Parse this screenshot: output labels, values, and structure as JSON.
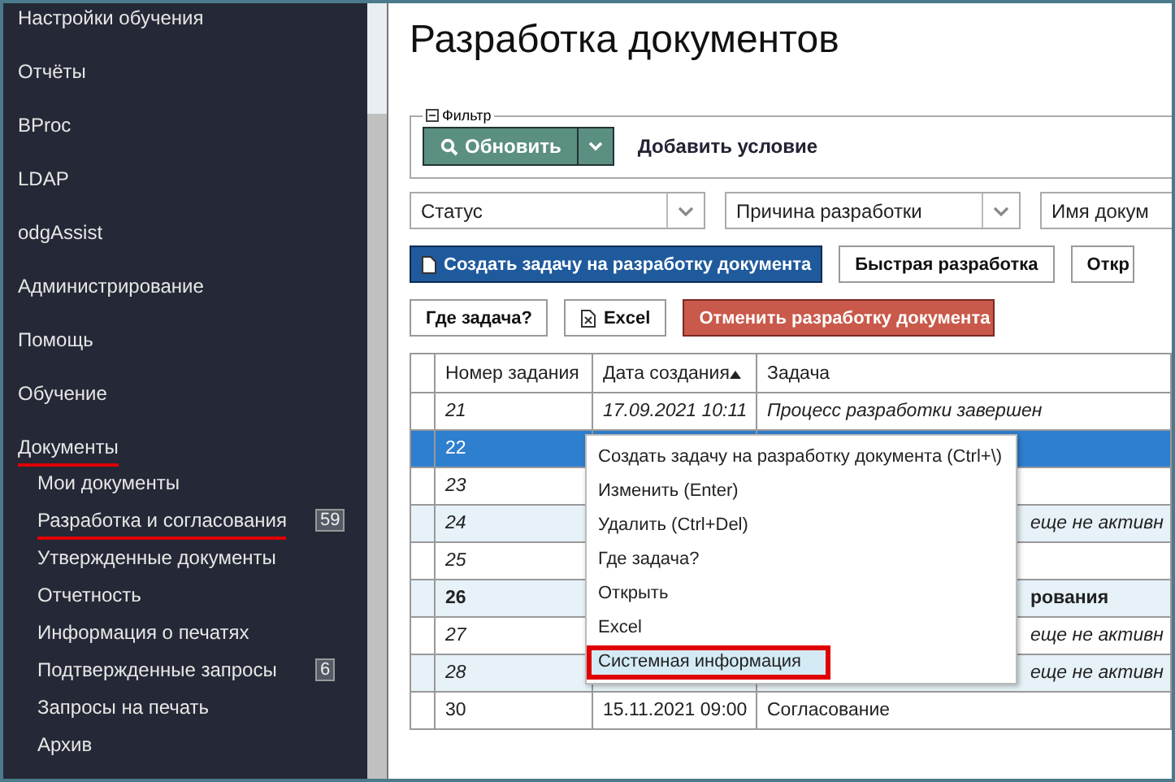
{
  "sidebar": {
    "items": [
      {
        "label": "Настройки обучения",
        "underlined": false
      },
      {
        "label": "Отчёты",
        "underlined": false
      },
      {
        "label": "BProc",
        "underlined": false
      },
      {
        "label": "LDAP",
        "underlined": false
      },
      {
        "label": "odgAssist",
        "underlined": false
      },
      {
        "label": "Администрирование",
        "underlined": false
      },
      {
        "label": "Помощь",
        "underlined": false
      },
      {
        "label": "Обучение",
        "underlined": false
      },
      {
        "label": "Документы",
        "underlined": true,
        "children": [
          {
            "label": "Мои документы",
            "underlined": false
          },
          {
            "label": "Разработка и согласования",
            "underlined": true,
            "badge": "59"
          },
          {
            "label": "Утвержденные документы",
            "underlined": false
          },
          {
            "label": "Отчетность",
            "underlined": false
          },
          {
            "label": "Информация о печатях",
            "underlined": false
          },
          {
            "label": "Подтвержденные запросы",
            "underlined": false,
            "badge": "6"
          },
          {
            "label": "Запросы на печать",
            "underlined": false
          },
          {
            "label": "Архив",
            "underlined": false
          }
        ]
      }
    ]
  },
  "page": {
    "title": "Разработка документов"
  },
  "filter": {
    "legend": "Фильтр",
    "expanded": true,
    "refresh_button": "Обновить",
    "add_condition": "Добавить условие"
  },
  "selects": [
    {
      "value": "Статус"
    },
    {
      "value": "Причина разработки"
    },
    {
      "value": "Имя докум"
    }
  ],
  "toolbar_rows": [
    [
      {
        "label": "Создать задачу на разработку документа",
        "kind": "primary"
      },
      {
        "label": "Быстрая разработка",
        "kind": "plain"
      },
      {
        "label": "Откр",
        "kind": "plain"
      }
    ],
    [
      {
        "label": "Где задача?",
        "kind": "plain"
      },
      {
        "label": "Excel",
        "kind": "excel"
      },
      {
        "label": "Отменить разработку документа",
        "kind": "danger"
      }
    ]
  ],
  "table": {
    "columns": [
      "Номер задания",
      "Дата создания",
      "Задача"
    ],
    "rows": [
      {
        "number": "21",
        "date": "17.09.2021 10:11",
        "task": "Процесс разработки завершен",
        "selected": false,
        "shaded": false,
        "kind": "finished",
        "partly_hidden": false
      },
      {
        "number": "22",
        "selected": true,
        "shaded": false,
        "kind": "normal"
      },
      {
        "number": "23",
        "selected": false,
        "shaded": false,
        "kind": "finished"
      },
      {
        "number": "24",
        "task": "еще не активн",
        "selected": false,
        "shaded": true,
        "kind": "finished",
        "partly_hidden": true
      },
      {
        "number": "25",
        "selected": false,
        "shaded": false,
        "kind": "finished"
      },
      {
        "number": "26",
        "task": "рования",
        "selected": false,
        "shaded": true,
        "kind": "urgent",
        "partly_hidden": true
      },
      {
        "number": "27",
        "task": "еще не активн",
        "selected": false,
        "shaded": false,
        "kind": "finished",
        "partly_hidden": true
      },
      {
        "number": "28",
        "task": "еще не активн",
        "selected": false,
        "shaded": true,
        "kind": "finished",
        "partly_hidden": true
      },
      {
        "number": "30",
        "date": "15.11.2021 09:00",
        "task": "Согласование",
        "selected": false,
        "shaded": false,
        "kind": "normal",
        "partly_hidden": false
      }
    ]
  },
  "context_menu": {
    "items": [
      {
        "label": "Создать задачу на разработку документа (Ctrl+\\)",
        "selected": false,
        "highlighted_box": false
      },
      {
        "label": "Изменить (Enter)",
        "selected": false,
        "highlighted_box": false
      },
      {
        "label": "Удалить (Ctrl+Del)",
        "selected": false,
        "highlighted_box": false
      },
      {
        "label": "Где задача?",
        "selected": false,
        "highlighted_box": false
      },
      {
        "label": "Открыть",
        "selected": false,
        "highlighted_box": false
      },
      {
        "label": "Excel",
        "selected": false,
        "highlighted_box": false
      },
      {
        "label": "Системная информация",
        "selected": true,
        "highlighted_box": true
      }
    ]
  }
}
